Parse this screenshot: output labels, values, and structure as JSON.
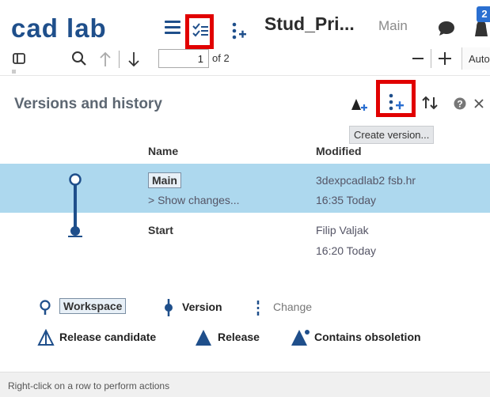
{
  "header": {
    "logo_text": "cad lab",
    "document_title": "Stud_Pri...",
    "branch": "Main",
    "notification_count": "2"
  },
  "toolbar2": {
    "page_current": "1",
    "page_total": "of 2",
    "zoom_label": "Auto"
  },
  "panel": {
    "title": "Versions and history",
    "tooltip": "Create version...",
    "columns": {
      "name": "Name",
      "modified": "Modified"
    },
    "rows": [
      {
        "name": "Main",
        "sub": "> Show changes...",
        "modified_by": "3dexpcadlab2 fsb.hr",
        "modified_time": "16:35 Today",
        "selected": true
      },
      {
        "name": "Start",
        "sub": "",
        "modified_by": "Filip Valjak",
        "modified_time": "16:20 Today",
        "selected": false
      }
    ]
  },
  "legend": {
    "workspace": "Workspace",
    "version": "Version",
    "change": "Change",
    "release_candidate": "Release candidate",
    "release": "Release",
    "contains_obsoletion": "Contains obsoletion"
  },
  "status": "Right-click on a row to perform actions",
  "colors": {
    "accent": "#1f4f8b",
    "selected_row": "#add8ee",
    "highlight_box": "#e10000"
  }
}
